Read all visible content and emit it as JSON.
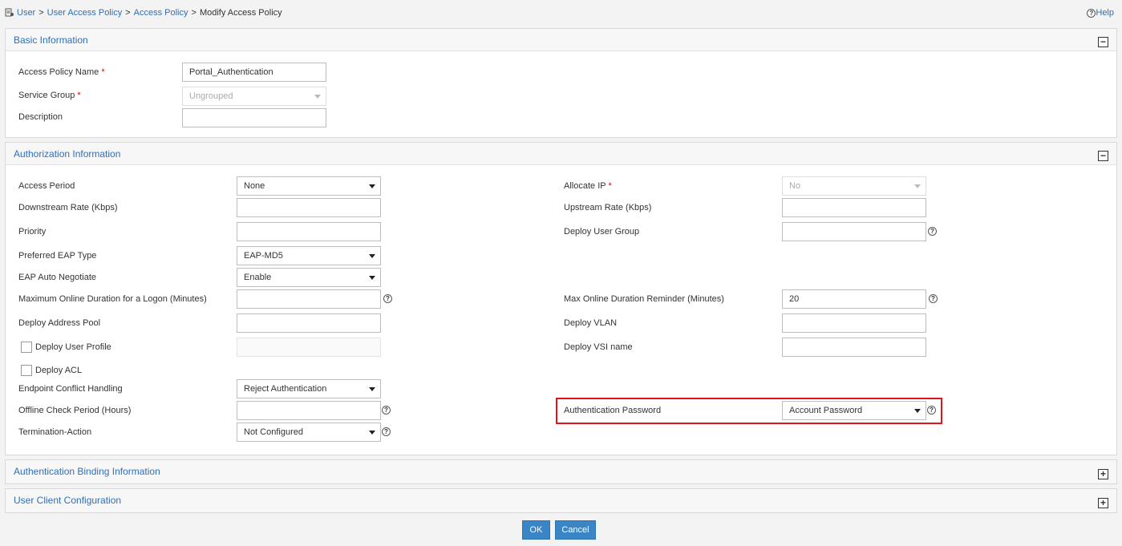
{
  "breadcrumb": {
    "items": [
      "User",
      "User Access Policy",
      "Access Policy"
    ],
    "separator": ">",
    "current": "Modify Access Policy"
  },
  "help": "Help",
  "icons": {
    "question": "?",
    "collapse": "−",
    "expand": "+",
    "breadcrumb": "user-policy-icon"
  },
  "colors": {
    "link": "#2f6fb6",
    "highlight": "#e0141c",
    "button": "#3a85c6",
    "required": "#d00"
  },
  "basic": {
    "title": "Basic Information",
    "policy_name_label": "Access Policy Name",
    "policy_name_value": "Portal_Authentication",
    "service_group_label": "Service Group",
    "service_group_value": "Ungrouped",
    "description_label": "Description",
    "description_value": "",
    "required_mark": "*"
  },
  "auth": {
    "title": "Authorization Information",
    "access_period": {
      "label": "Access Period",
      "value": "None"
    },
    "downstream_rate": {
      "label": "Downstream Rate (Kbps)",
      "value": ""
    },
    "priority": {
      "label": "Priority",
      "value": ""
    },
    "preferred_eap": {
      "label": "Preferred EAP Type",
      "value": "EAP-MD5"
    },
    "eap_auto": {
      "label": "EAP Auto Negotiate",
      "value": "Enable"
    },
    "max_online": {
      "label": "Maximum Online Duration for a Logon (Minutes)",
      "value": ""
    },
    "address_pool": {
      "label": "Deploy Address Pool",
      "value": ""
    },
    "user_profile": {
      "label": "Deploy User Profile",
      "checked": false,
      "value": ""
    },
    "acl": {
      "label": "Deploy ACL",
      "checked": false
    },
    "endpoint_conflict": {
      "label": "Endpoint Conflict Handling",
      "value": "Reject Authentication"
    },
    "offline_check": {
      "label": "Offline Check Period (Hours)",
      "value": ""
    },
    "termination": {
      "label": "Termination-Action",
      "value": "Not Configured"
    },
    "allocate_ip": {
      "label": "Allocate IP",
      "value": "No"
    },
    "upstream_rate": {
      "label": "Upstream Rate (Kbps)",
      "value": ""
    },
    "user_group": {
      "label": "Deploy User Group",
      "value": ""
    },
    "max_reminder": {
      "label": "Max Online Duration Reminder (Minutes)",
      "value": "20"
    },
    "vlan": {
      "label": "Deploy VLAN",
      "value": ""
    },
    "vsi": {
      "label": "Deploy VSI name",
      "value": ""
    },
    "auth_password": {
      "label": "Authentication Password",
      "value": "Account Password"
    }
  },
  "binding": {
    "title": "Authentication Binding Information"
  },
  "client": {
    "title": "User Client Configuration"
  },
  "buttons": {
    "ok": "OK",
    "cancel": "Cancel"
  }
}
